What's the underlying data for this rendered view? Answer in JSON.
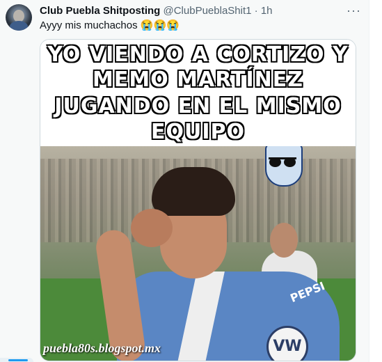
{
  "post": {
    "author_name": "Club Puebla Shitposting",
    "author_handle": "@ClubPueblaShit1",
    "separator": " · ",
    "time_ago": "1h",
    "more_label": "···",
    "text": "Ayyy mis muchachos 😭😭😭"
  },
  "meme": {
    "caption_lines": [
      "YO VIENDO A CORTIZO Y",
      "MEMO MARTÍNEZ",
      "JUGANDO EN EL MISMO",
      "EQUIPO"
    ],
    "watermark": "puebla80s.blogspot.mx",
    "shirt_sponsor": "PEPSI",
    "chest_logo": "VW"
  },
  "colors": {
    "name": "#0f1419",
    "secondary": "#536471",
    "accent": "#1d9bf0",
    "tweet_bg": "#f7f9f9"
  }
}
